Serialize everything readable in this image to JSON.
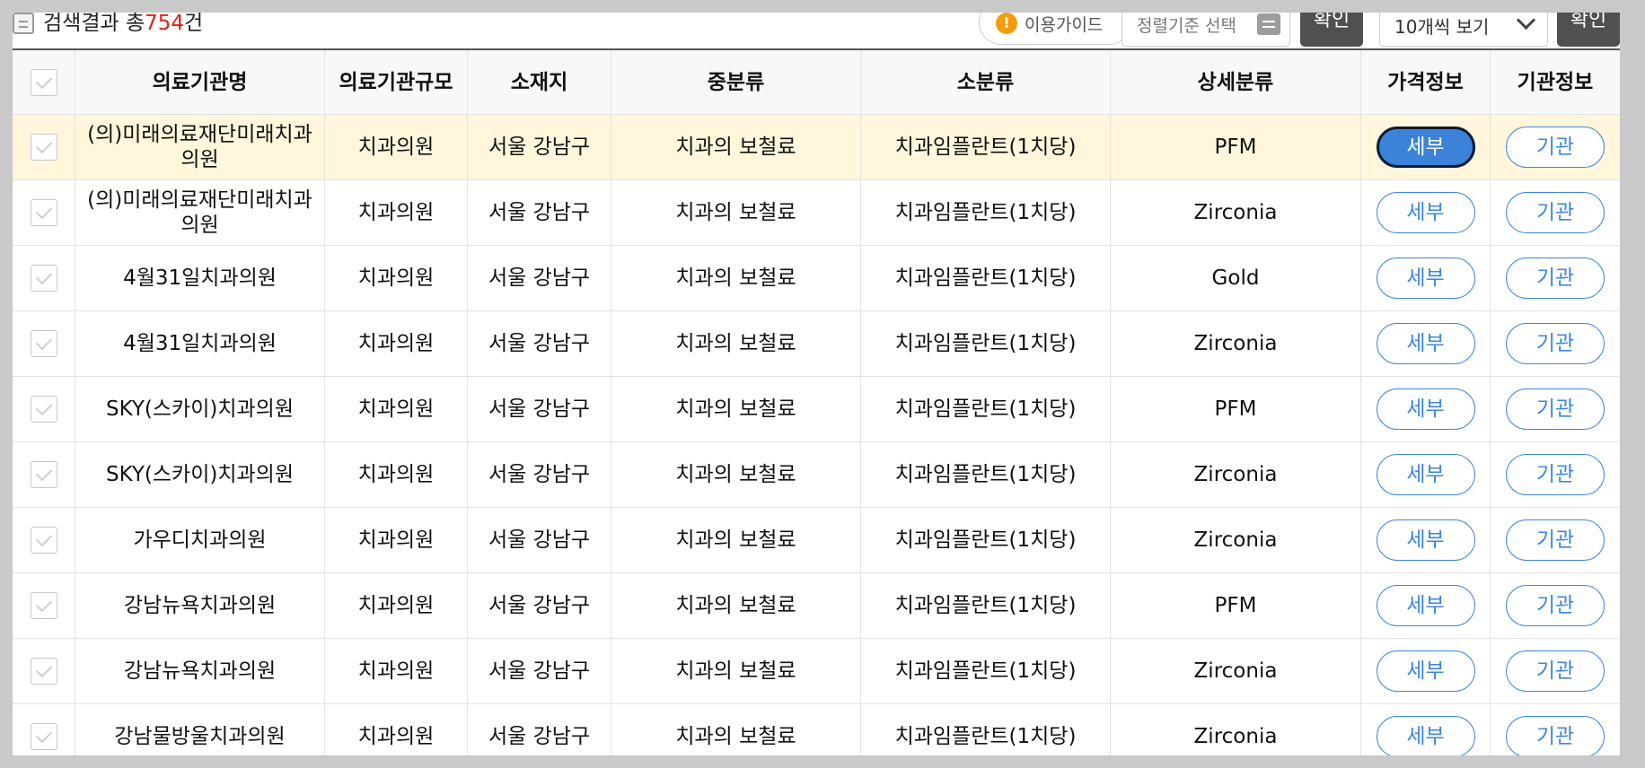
{
  "toolbar": {
    "result_prefix": "검색결과 총",
    "result_count": "754",
    "result_suffix": "건",
    "guide_label": "이용가이드",
    "sort_placeholder": "정렬기준 선택",
    "confirm_label": "확인",
    "per_page_value": "10개씩 보기"
  },
  "table": {
    "headers": [
      "의료기관명",
      "의료기관규모",
      "소재지",
      "중분류",
      "소분류",
      "상세분류",
      "가격정보",
      "기관정보"
    ],
    "detail_button_label": "세부",
    "institution_button_label": "기관",
    "rows": [
      {
        "name": "(의)미래의료재단미래치과의원",
        "scale": "치과의원",
        "location": "서울 강남구",
        "mid": "치과의 보철료",
        "sub": "치과임플란트(1치당)",
        "detail": "PFM"
      },
      {
        "name": "(의)미래의료재단미래치과의원",
        "scale": "치과의원",
        "location": "서울 강남구",
        "mid": "치과의 보철료",
        "sub": "치과임플란트(1치당)",
        "detail": "Zirconia"
      },
      {
        "name": "4월31일치과의원",
        "scale": "치과의원",
        "location": "서울 강남구",
        "mid": "치과의 보철료",
        "sub": "치과임플란트(1치당)",
        "detail": "Gold"
      },
      {
        "name": "4월31일치과의원",
        "scale": "치과의원",
        "location": "서울 강남구",
        "mid": "치과의 보철료",
        "sub": "치과임플란트(1치당)",
        "detail": "Zirconia"
      },
      {
        "name": "SKY(스카이)치과의원",
        "scale": "치과의원",
        "location": "서울 강남구",
        "mid": "치과의 보철료",
        "sub": "치과임플란트(1치당)",
        "detail": "PFM"
      },
      {
        "name": "SKY(스카이)치과의원",
        "scale": "치과의원",
        "location": "서울 강남구",
        "mid": "치과의 보철료",
        "sub": "치과임플란트(1치당)",
        "detail": "Zirconia"
      },
      {
        "name": "가우디치과의원",
        "scale": "치과의원",
        "location": "서울 강남구",
        "mid": "치과의 보철료",
        "sub": "치과임플란트(1치당)",
        "detail": "Zirconia"
      },
      {
        "name": "강남뉴욕치과의원",
        "scale": "치과의원",
        "location": "서울 강남구",
        "mid": "치과의 보철료",
        "sub": "치과임플란트(1치당)",
        "detail": "PFM"
      },
      {
        "name": "강남뉴욕치과의원",
        "scale": "치과의원",
        "location": "서울 강남구",
        "mid": "치과의 보철료",
        "sub": "치과임플란트(1치당)",
        "detail": "Zirconia"
      },
      {
        "name": "강남물방울치과의원",
        "scale": "치과의원",
        "location": "서울 강남구",
        "mid": "치과의 보철료",
        "sub": "치과임플란트(1치당)",
        "detail": "Zirconia"
      }
    ]
  },
  "colors": {
    "count_red": "#e02020",
    "accent_blue": "#3d86df",
    "highlight_row": "#fff6db",
    "dark_button": "#505050"
  }
}
